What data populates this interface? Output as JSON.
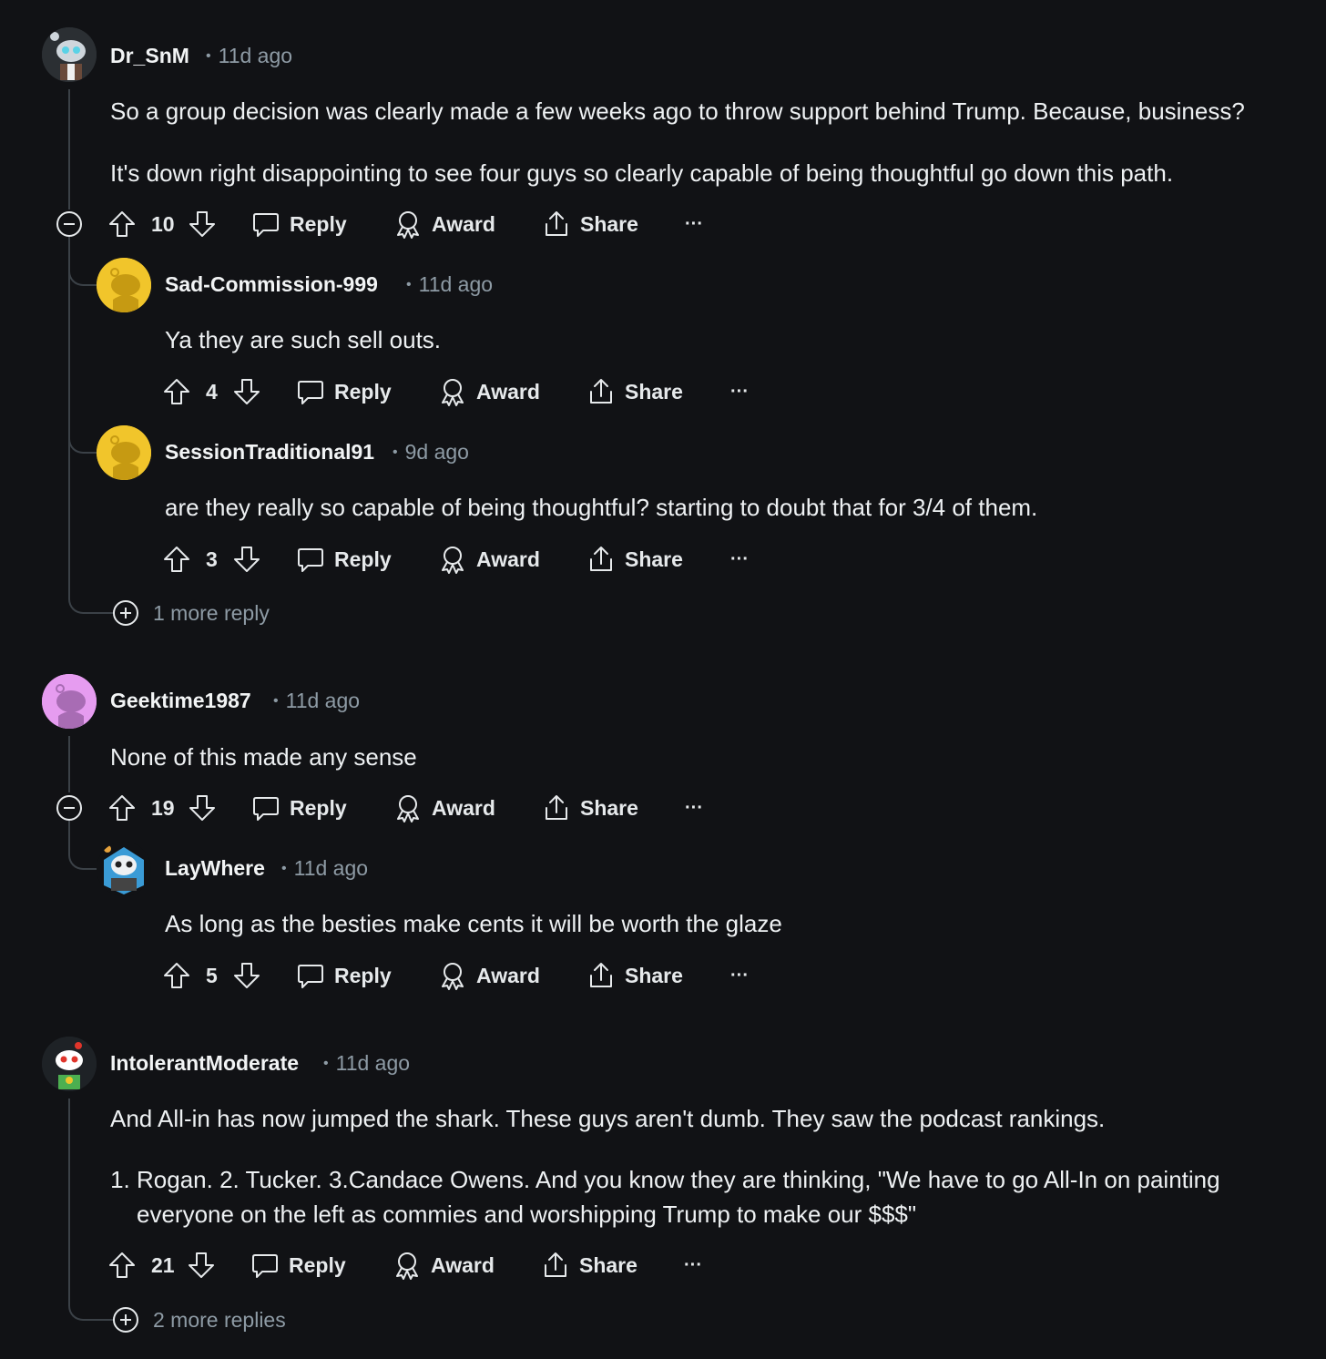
{
  "actions": {
    "reply": "Reply",
    "award": "Award",
    "share": "Share",
    "overflow": "···"
  },
  "comments": [
    {
      "author": "Dr_SnM",
      "time": "11d ago",
      "paragraphs": [
        "So a group decision was clearly made a few weeks ago to throw support behind Trump. Because, business?",
        "It's down right disappointing to see four guys so clearly capable of being thoughtful go down this path."
      ],
      "votes": "10",
      "replies": [
        {
          "author": "Sad-Commission-999",
          "time": "11d ago",
          "text": "Ya they are such sell outs.",
          "votes": "4"
        },
        {
          "author": "SessionTraditional91",
          "time": "9d ago",
          "text": "are they really so capable of being thoughtful? starting to doubt that for 3/4 of them.",
          "votes": "3"
        }
      ],
      "more_replies": "1 more reply"
    },
    {
      "author": "Geektime1987",
      "time": "11d ago",
      "paragraphs": [
        "None of this made any sense"
      ],
      "votes": "19",
      "replies": [
        {
          "author": "LayWhere",
          "time": "11d ago",
          "text": "As long as the besties make cents it will be worth the glaze",
          "votes": "5"
        }
      ]
    },
    {
      "author": "IntolerantModerate",
      "time": "11d ago",
      "paragraphs": [
        "And All-in has now jumped the shark. These guys aren't dumb. They saw the podcast rankings."
      ],
      "list_items": [
        "Rogan. 2. Tucker. 3.Candace Owens. And you know they are thinking, \"We have to go All-In on painting everyone on the left as commies and worshipping Trump to make our $$$\""
      ],
      "votes": "21",
      "more_replies": "2 more replies"
    }
  ],
  "colors": {
    "background": "#111215",
    "text": "#eef1f3",
    "muted": "#8e9ba5",
    "thread_line": "#3b4147",
    "avatar_yellow": "#f1c52b",
    "avatar_purple": "#e69cf0"
  }
}
